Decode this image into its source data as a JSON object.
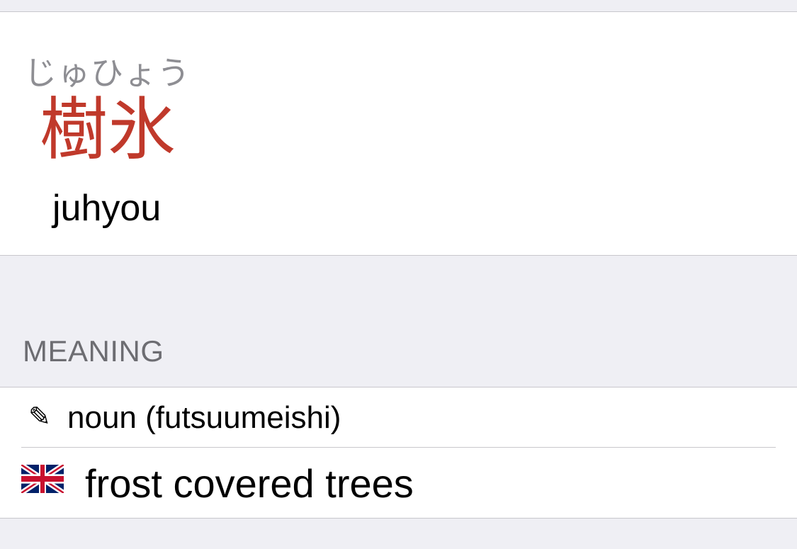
{
  "entry": {
    "kana": "じゅひょう",
    "kanji": "樹氷",
    "romaji": "juhyou"
  },
  "meaning_section": {
    "header": "MEANING",
    "part_of_speech": "noun (futsuumeishi)",
    "part_of_speech_icon": "pencil-icon",
    "definition": "frost covered trees",
    "definition_icon": "uk-flag-icon"
  },
  "colors": {
    "kanji": "#c0392b",
    "kana": "#8e8e93",
    "section_header": "#6d6d72",
    "grouped_background": "#efeff4",
    "separator": "#c8c7cc"
  }
}
